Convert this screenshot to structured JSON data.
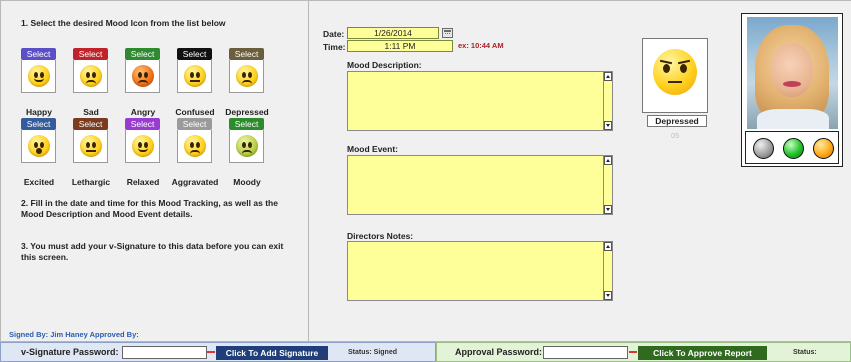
{
  "instructions": {
    "step1": "1. Select the desired Mood Icon from the list below",
    "step2": "2. Fill in the date and time for this Mood Tracking, as well as the Mood Description and Mood Event details.",
    "step3": "3. You must add your v-Signature to this data before you can exit this screen."
  },
  "moods": [
    {
      "select": "Select",
      "label": "Happy",
      "color": "#5b4fc7",
      "face": "smile"
    },
    {
      "select": "Select",
      "label": "Sad",
      "color": "#c0242a",
      "face": "frown"
    },
    {
      "select": "Select",
      "label": "Angry",
      "color": "#2f8a2f",
      "face": "angry"
    },
    {
      "select": "Select",
      "label": "Confused",
      "color": "#111111",
      "face": "flat"
    },
    {
      "select": "Select",
      "label": "Depressed",
      "color": "#6b5e3c",
      "face": "frown"
    },
    {
      "select": "Select",
      "label": "Excited",
      "color": "#345b9c",
      "face": "open"
    },
    {
      "select": "Select",
      "label": "Lethargic",
      "color": "#7a3b1e",
      "face": "flat"
    },
    {
      "select": "Select",
      "label": "Relaxed",
      "color": "#9a3bd0",
      "face": "smile"
    },
    {
      "select": "Select",
      "label": "Aggravated",
      "color": "#9a9a9a",
      "face": "frown"
    },
    {
      "select": "Select",
      "label": "Moody",
      "color": "#2e8a2e",
      "face": "green"
    }
  ],
  "signed_by": "Signed By: Jim Haney   Approved By:",
  "form": {
    "date_label": "Date:",
    "date_value": "1/26/2014",
    "time_label": "Time:",
    "time_value": "1:11 PM",
    "time_example": "ex: 10:44 AM",
    "mood_description_label": "Mood Description:",
    "mood_event_label": "Mood Event:",
    "directors_notes_label": "Directors Notes:"
  },
  "selected_mood": {
    "name": "Depressed",
    "code": "05"
  },
  "status_lights": [
    "gray",
    "green",
    "orange"
  ],
  "signature_bar": {
    "password_label": "v-Signature Password:",
    "button": "Click To Add Signature",
    "status": "Status: Signed"
  },
  "approval_bar": {
    "password_label": "Approval Password:",
    "button": "Click To Approve Report",
    "status": "Status:"
  }
}
